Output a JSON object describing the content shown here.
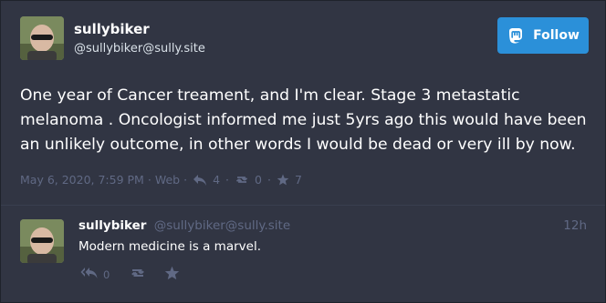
{
  "status": {
    "display_name": "sullybiker",
    "acct": "@sullybiker@sully.site",
    "follow_label": "Follow",
    "content": "One year of Cancer treament, and I'm clear. Stage 3 metastatic melanoma . Oncologist informed me just 5yrs ago this would have been an unlikely outcome, in other words I would be dead or very ill by now.",
    "timestamp": "May 6, 2020, 7:59 PM",
    "separator": "·",
    "application": "Web",
    "replies_count": "4",
    "reblogs_count": "0",
    "favourites_count": "7"
  },
  "reply": {
    "display_name": "sullybiker",
    "acct": "@sullybiker@sully.site",
    "relative_time": "12h",
    "content": "Modern medicine is a marvel.",
    "replies_count": "0"
  },
  "icons": {
    "follow": "mastodon-logo-icon",
    "reply": "reply-icon",
    "reply_all": "reply-all-icon",
    "boost": "retweet-icon",
    "favourite": "star-icon"
  },
  "colors": {
    "background": "#313543",
    "accent": "#2b90d9",
    "muted": "#606984",
    "text": "#ffffff"
  }
}
